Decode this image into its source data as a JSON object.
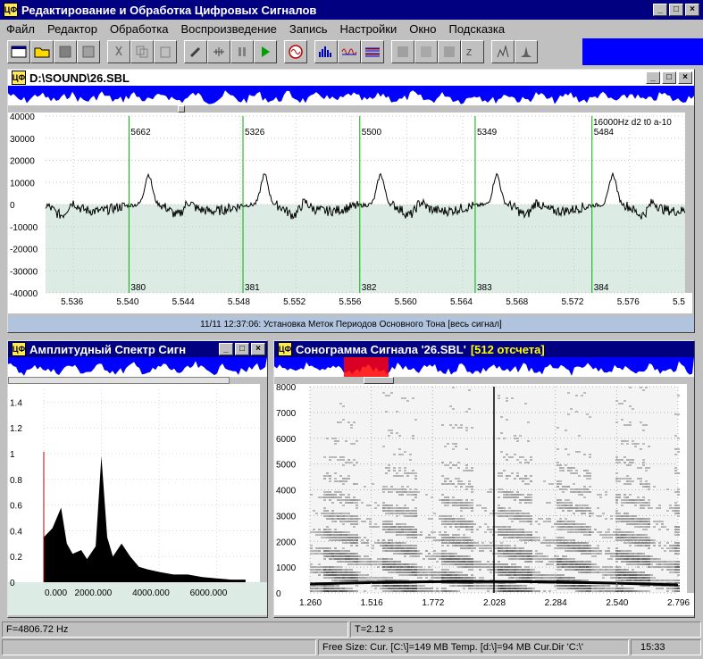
{
  "app": {
    "title": "Редактирование и Обработка Цифровых Сигналов",
    "icon": "ЦФ"
  },
  "menu": [
    "Файл",
    "Редактор",
    "Обработка",
    "Воспроизведение",
    "Запись",
    "Настройки",
    "Окно",
    "Подсказка"
  ],
  "waveform": {
    "title": "D:\\SOUND\\26.SBL",
    "y_ticks": [
      "40000",
      "30000",
      "20000",
      "10000",
      "0",
      "-10000",
      "-20000",
      "-30000",
      "-40000"
    ],
    "x_ticks": [
      "5.536",
      "5.540",
      "5.544",
      "5.548",
      "5.552",
      "5.556",
      "5.560",
      "5.564",
      "5.568",
      "5.572",
      "5.576",
      "5.5"
    ],
    "info": "16000Hz d2 t0 a-10",
    "markers": [
      {
        "value": "5662",
        "index": "380"
      },
      {
        "value": "5326",
        "index": "381"
      },
      {
        "value": "5500",
        "index": "382"
      },
      {
        "value": "5349",
        "index": "383"
      },
      {
        "value": "5484",
        "index": "384"
      }
    ],
    "status": "11/11 12:37:06: Установка Меток Периодов Основного Тона [весь сигнал]"
  },
  "spectrum": {
    "title": "Амплитудный Спектр Сигн",
    "y_ticks": [
      "1.4",
      "1.2",
      "1",
      "0.8",
      "0.6",
      "0.4",
      "0.2",
      "0"
    ],
    "x_ticks": [
      "0.000",
      "2000.000",
      "4000.000",
      "6000.000"
    ]
  },
  "sonogram": {
    "title": "Сонограмма Сигнала '26.SBL'",
    "title_extra": "[512 отсчета]",
    "y_ticks": [
      "8000",
      "7000",
      "6000",
      "5000",
      "4000",
      "3000",
      "2000",
      "1000",
      "0"
    ],
    "x_ticks": [
      "1.260",
      "1.516",
      "1.772",
      "2.028",
      "2.284",
      "2.540",
      "2.796"
    ]
  },
  "statusbar": {
    "freq": "F=4806.72 Hz",
    "time": "T=2.12 s",
    "free": "Free Size: Cur. [C:\\]=149 MB Temp. [d:\\]=94 MB Cur.Dir 'C:\\'",
    "clock": "15:33"
  },
  "chart_data": [
    {
      "type": "line",
      "title": "D:\\SOUND\\26.SBL",
      "xlim": [
        5.534,
        5.58
      ],
      "ylim": [
        -40000,
        40000
      ],
      "markers_x": [
        5.54,
        5.5482,
        5.5566,
        5.5649,
        5.5733
      ],
      "peaks": [
        {
          "x": 5.5414,
          "y": 14000
        },
        {
          "x": 5.5496,
          "y": 13000
        },
        {
          "x": 5.558,
          "y": 13000
        },
        {
          "x": 5.5663,
          "y": 13000
        },
        {
          "x": 5.5747,
          "y": 13000
        }
      ]
    },
    {
      "type": "area",
      "title": "Амплитудный Спектр Сигн",
      "xlim": [
        0,
        7500
      ],
      "ylim": [
        0,
        1.5
      ],
      "x": [
        0,
        300,
        600,
        800,
        1000,
        1300,
        1500,
        1800,
        2000,
        2200,
        2400,
        2700,
        3000,
        3300,
        3600,
        4000,
        4500,
        5000,
        5500,
        6000,
        6500,
        7000
      ],
      "y": [
        0.35,
        0.42,
        0.58,
        0.3,
        0.22,
        0.25,
        0.18,
        0.28,
        0.98,
        0.35,
        0.2,
        0.3,
        0.2,
        0.12,
        0.1,
        0.08,
        0.06,
        0.06,
        0.04,
        0.03,
        0.02,
        0.02
      ]
    },
    {
      "type": "heatmap",
      "title": "Сонограмма Сигнала '26.SBL'",
      "xlim": [
        1.26,
        2.796
      ],
      "ylim": [
        0,
        8000
      ]
    }
  ]
}
